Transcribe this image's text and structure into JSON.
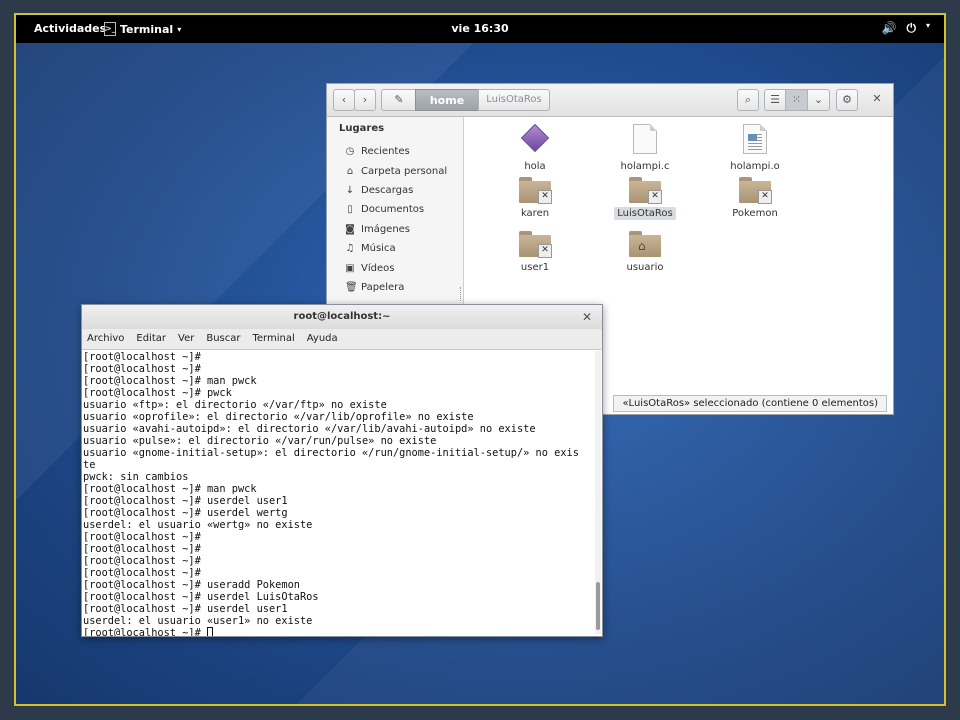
{
  "topbar": {
    "activities": "Actividades",
    "app_name": "Terminal",
    "clock": "vie 16:30"
  },
  "files": {
    "breadcrumb": [
      "home",
      "LuisOtaRos"
    ],
    "sidebar_heading": "Lugares",
    "sidebar_items": [
      {
        "label": "Recientes",
        "icon": "clock-icon"
      },
      {
        "label": "Carpeta personal",
        "icon": "home-icon"
      },
      {
        "label": "Descargas",
        "icon": "download-icon"
      },
      {
        "label": "Documentos",
        "icon": "document-icon"
      },
      {
        "label": "Imágenes",
        "icon": "camera-icon"
      },
      {
        "label": "Música",
        "icon": "music-icon"
      },
      {
        "label": "Vídeos",
        "icon": "video-icon"
      },
      {
        "label": "Papelera",
        "icon": "trash-icon"
      }
    ],
    "items": [
      {
        "name": "hola",
        "kind": "executable"
      },
      {
        "name": "holampi.c",
        "kind": "text"
      },
      {
        "name": "holampi.o",
        "kind": "object"
      },
      {
        "name": "karen",
        "kind": "folder-locked"
      },
      {
        "name": "LuisOtaRos",
        "kind": "folder-locked",
        "selected": true
      },
      {
        "name": "Pokemon",
        "kind": "folder-locked"
      },
      {
        "name": "user1",
        "kind": "folder-locked"
      },
      {
        "name": "usuario",
        "kind": "folder-home"
      }
    ],
    "status": "«LuisOtaRos» seleccionado (contiene 0 elementos)"
  },
  "terminal": {
    "title": "root@localhost:~",
    "menu": [
      "Archivo",
      "Editar",
      "Ver",
      "Buscar",
      "Terminal",
      "Ayuda"
    ],
    "lines": [
      "[root@localhost ~]#",
      "[root@localhost ~]#",
      "[root@localhost ~]# man pwck",
      "[root@localhost ~]# pwck",
      "usuario «ftp»: el directorio «/var/ftp» no existe",
      "usuario «oprofile»: el directorio «/var/lib/oprofile» no existe",
      "usuario «avahi-autoipd»: el directorio «/var/lib/avahi-autoipd» no existe",
      "usuario «pulse»: el directorio «/var/run/pulse» no existe",
      "usuario «gnome-initial-setup»: el directorio «/run/gnome-initial-setup/» no exis",
      "te",
      "pwck: sin cambios",
      "[root@localhost ~]# man pwck",
      "[root@localhost ~]# userdel user1",
      "[root@localhost ~]# userdel wertg",
      "userdel: el usuario «wertg» no existe",
      "[root@localhost ~]#",
      "[root@localhost ~]#",
      "[root@localhost ~]#",
      "[root@localhost ~]#",
      "[root@localhost ~]# useradd Pokemon",
      "[root@localhost ~]# userdel LuisOtaRos",
      "[root@localhost ~]# userdel user1",
      "userdel: el usuario «user1» no existe"
    ],
    "prompt": "[root@localhost ~]# "
  }
}
